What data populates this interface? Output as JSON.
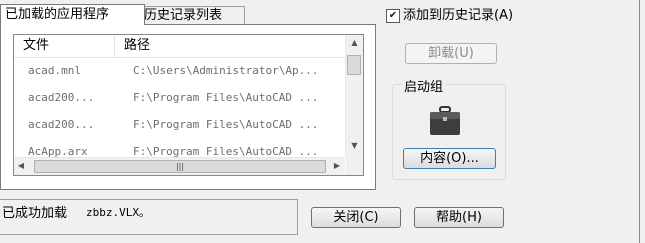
{
  "tabs": [
    {
      "label": "已加载的应用程序"
    },
    {
      "label": "历史记录列表"
    }
  ],
  "list": {
    "columns": [
      "文件",
      "路径"
    ],
    "rows": [
      {
        "file": "acad.mnl",
        "path": "C:\\Users\\Administrator\\Ap..."
      },
      {
        "file": "acad200...",
        "path": "F:\\Program Files\\AutoCAD ..."
      },
      {
        "file": "acad200...",
        "path": "F:\\Program Files\\AutoCAD ..."
      },
      {
        "file": "AcApp.arx",
        "path": "F:\\Program Files\\AutoCAD ..."
      }
    ]
  },
  "add_to_history": {
    "label": "添加到历史记录(A)",
    "checked": true
  },
  "unload_button": {
    "label": "卸载(U)"
  },
  "startup_group": {
    "title": "启动组",
    "icon": "briefcase-icon",
    "contents_button": "内容(O)..."
  },
  "status": {
    "label": "已成功加载",
    "file": "zbbz.VLX。"
  },
  "close_button": {
    "label": "关闭(C)"
  },
  "help_button": {
    "label": "帮助(H)"
  }
}
